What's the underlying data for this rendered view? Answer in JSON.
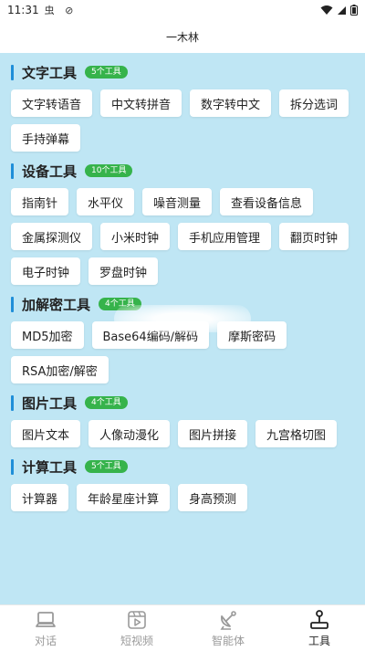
{
  "status_bar": {
    "time": "11:31",
    "left_icons": "虫 ⊘"
  },
  "header": {
    "title": "一木林"
  },
  "sections": [
    {
      "title": "文字工具",
      "count": "5个工具",
      "items": [
        "文字转语音",
        "中文转拼音",
        "数字转中文",
        "拆分选词",
        "手持弹幕"
      ]
    },
    {
      "title": "设备工具",
      "count": "10个工具",
      "items": [
        "指南针",
        "水平仪",
        "噪音测量",
        "查看设备信息",
        "金属探测仪",
        "小米时钟",
        "手机应用管理",
        "翻页时钟",
        "电子时钟",
        "罗盘时钟"
      ]
    },
    {
      "title": "加解密工具",
      "count": "4个工具",
      "items": [
        "MD5加密",
        "Base64编码/解码",
        "摩斯密码",
        "RSA加密/解密"
      ]
    },
    {
      "title": "图片工具",
      "count": "4个工具",
      "items": [
        "图片文本",
        "人像动漫化",
        "图片拼接",
        "九宫格切图"
      ]
    },
    {
      "title": "计算工具",
      "count": "5个工具",
      "items": [
        "计算器",
        "年龄星座计算",
        "身高预测"
      ]
    }
  ],
  "bottom_nav": [
    {
      "label": "对话",
      "icon": "laptop-icon",
      "active": false
    },
    {
      "label": "短视频",
      "icon": "video-icon",
      "active": false
    },
    {
      "label": "智能体",
      "icon": "satellite-dish-icon",
      "active": false
    },
    {
      "label": "工具",
      "icon": "tools-icon",
      "active": true
    }
  ],
  "colors": {
    "background": "#bfe6f4",
    "accent_bar": "#1f8ed8",
    "badge": "#36b34b",
    "nav_inactive": "#9a9a9a",
    "nav_active": "#222222"
  }
}
